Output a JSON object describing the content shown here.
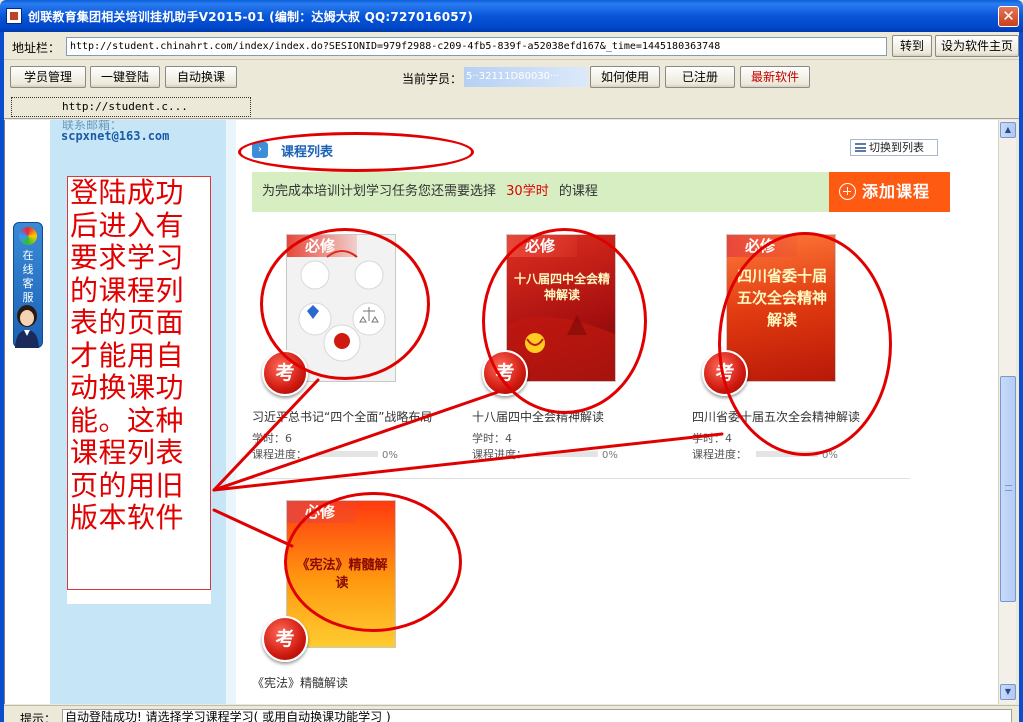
{
  "window": {
    "title": "创联教育集团相关培训挂机助手V2015-01 (编制：达姆大叔 QQ:727016057)"
  },
  "address_bar": {
    "label": "地址栏：",
    "url": "http://student.chinahrt.com/index/index.do?SESIONID=979f2988-c209-4fb5-839f-a52038efd167&_time=1445180363748",
    "go_label": "转到",
    "homepage_label": "设为软件主页"
  },
  "toolbar": {
    "student_mgmt": "学员管理",
    "one_click_login": "一键登陆",
    "auto_switch": "自动换课",
    "current_student_label": "当前学员：",
    "current_student_value": "5··32111D80030···",
    "how_to_use": "如何使用",
    "registered": "已注册",
    "latest_software": "最新软件"
  },
  "tab": {
    "label": "http://student.c..."
  },
  "sidebar": {
    "faded_text": "联系邮箱：",
    "email": "scpxnet@163.com",
    "annotation": "登陆成功后进入有要求学习的课程列表的页面才能用自动换课功能。这种课程列表页的用旧版本软件",
    "customer_service": "在线客服"
  },
  "course_list": {
    "title": "课程列表",
    "switch_label": "切换到列表",
    "notice_prefix": "为完成本培训计划学习任务您还需要选择",
    "notice_hours": "30学时",
    "notice_suffix": "的课程",
    "add_course": "添加课程",
    "badge": "必修",
    "exam_badge": "考",
    "hours_label": "学时：",
    "progress_label": "课程进度：",
    "courses": [
      {
        "title": "习近平总书记“四个全面”战略布局",
        "hours": "6",
        "progress": "0%",
        "image_text": ""
      },
      {
        "title": "十八届四中全会精神解读",
        "hours": "4",
        "progress": "0%",
        "image_text": "十八届四中全会精神解读"
      },
      {
        "title": "四川省委十届五次全会精神解读",
        "hours": "4",
        "progress": "0%",
        "image_text": "四川省委十届五次全会精神解读"
      },
      {
        "title": "《宪法》精髓解读",
        "hours": "",
        "progress": "",
        "image_text": "《宪法》精髓解读"
      }
    ]
  },
  "status_bar": {
    "label": "提示：",
    "message": "自动登陆成功! 请选择学习课程学习( 或用自动换课功能学习 )"
  },
  "colors": {
    "titlebar": "#0856d8",
    "sidebar": "#c6e6f8",
    "notice_bg": "#d6eec2",
    "add_button": "#ff5a12",
    "annotation_red": "#e00000",
    "link_blue": "#1c62b6"
  },
  "icons": {
    "app": "app-icon",
    "close": "close-icon",
    "list": "list-icon",
    "plus": "plus-circle-icon",
    "customer_service": "customer-service-icon"
  }
}
